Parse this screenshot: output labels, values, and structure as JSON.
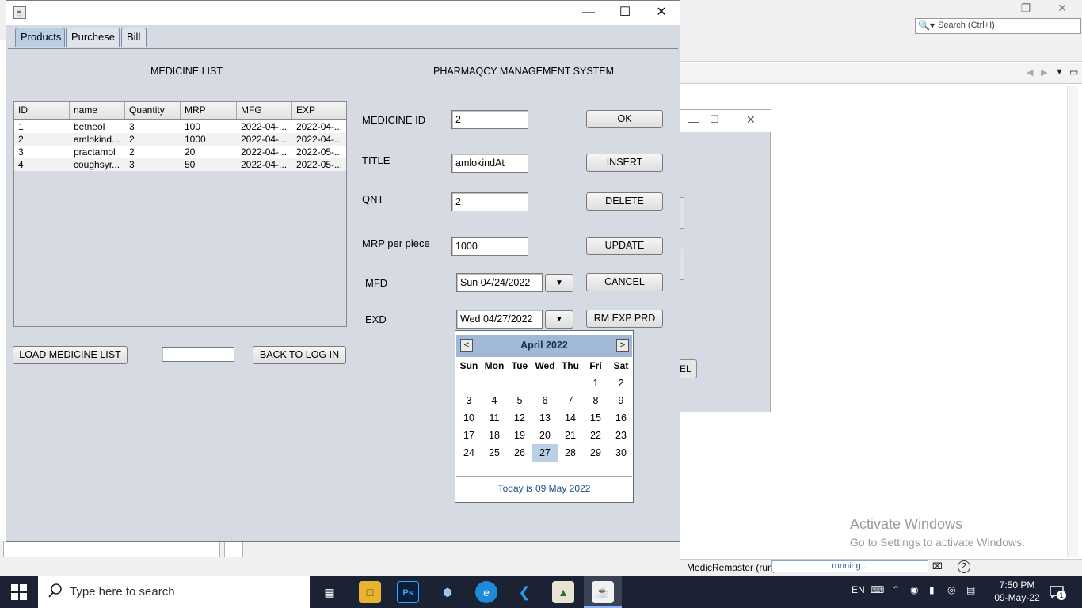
{
  "ide": {
    "search_placeholder": "Search (Ctrl+I)",
    "run_label": "MedicRemaster (run)",
    "run_status": "running...",
    "notification_badge": "2",
    "activate_title": "Activate Windows",
    "activate_subtitle": "Go to Settings to activate Windows.",
    "bg_dialog_button": "EL"
  },
  "app": {
    "tabs": [
      {
        "label": "Products"
      },
      {
        "label": "Purchese"
      },
      {
        "label": "Bill"
      }
    ],
    "medicine_list_title": "MEDICINE LIST",
    "system_title": "PHARMAQCY MANAGEMENT SYSTEM",
    "table": {
      "columns": [
        "ID",
        "name",
        "Quantity",
        "MRP",
        "MFG",
        "EXP"
      ],
      "rows": [
        [
          "1",
          "betneol",
          "3",
          "100",
          "2022-04-...",
          "2022-04-..."
        ],
        [
          "2",
          "amlokind...",
          "2",
          "1000",
          "2022-04-...",
          "2022-04-..."
        ],
        [
          "3",
          "practamol",
          "2",
          "20",
          "2022-04-...",
          "2022-05-..."
        ],
        [
          "4",
          "coughsyr...",
          "3",
          "50",
          "2022-04-...",
          "2022-05-..."
        ]
      ]
    },
    "form": {
      "medicine_id_label": "MEDICINE ID",
      "medicine_id_value": "2",
      "title_label": "TITLE",
      "title_value": "amlokindAt",
      "qnt_label": "QNT",
      "qnt_value": "2",
      "mrp_label": "MRP per piece",
      "mrp_value": "1000",
      "mfd_label": "MFD",
      "mfd_value": "Sun 04/24/2022",
      "exd_label": "EXD",
      "exd_value": "Wed 04/27/2022"
    },
    "buttons": {
      "ok": "OK",
      "insert": "INSERT",
      "delete": "DELETE",
      "update": "UPDATE",
      "cancel": "CANCEL",
      "rm_exp": "RM EXP PRD",
      "load_list": "LOAD MEDICINE LIST",
      "back_login": "BACK TO LOG IN"
    },
    "bottom_field_value": ""
  },
  "calendar": {
    "title": "April 2022",
    "prev": "<",
    "next": ">",
    "weekdays": [
      "Sun",
      "Mon",
      "Tue",
      "Wed",
      "Thu",
      "Fri",
      "Sat"
    ],
    "weeks": [
      [
        "",
        "",
        "",
        "",
        "",
        "1",
        "2"
      ],
      [
        "3",
        "4",
        "5",
        "6",
        "7",
        "8",
        "9"
      ],
      [
        "10",
        "11",
        "12",
        "13",
        "14",
        "15",
        "16"
      ],
      [
        "17",
        "18",
        "19",
        "20",
        "21",
        "22",
        "23"
      ],
      [
        "24",
        "25",
        "26",
        "27",
        "28",
        "29",
        "30"
      ]
    ],
    "selected_day": "27",
    "today_text": "Today is  09 May 2022"
  },
  "taskbar": {
    "search_placeholder": "Type here to search",
    "language": "EN",
    "time": "7:50 PM",
    "date": "09-May-22",
    "notification_count": "1"
  }
}
